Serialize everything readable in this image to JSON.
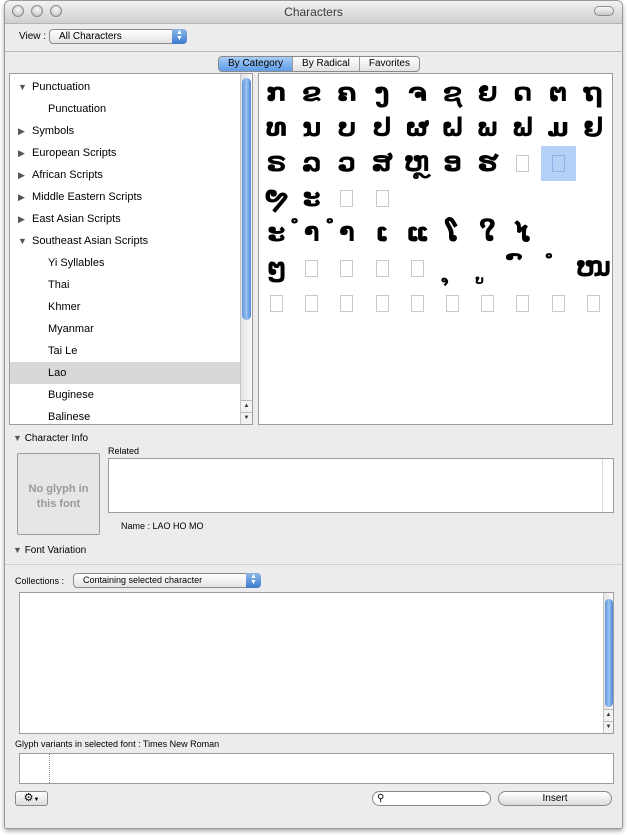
{
  "window": {
    "title": "Characters"
  },
  "view": {
    "label": "View :",
    "value": "All Characters"
  },
  "tabs": [
    "By Category",
    "By Radical",
    "Favorites"
  ],
  "categories": [
    {
      "label": "Punctuation",
      "expanded": true,
      "level": 0
    },
    {
      "label": "Punctuation",
      "level": 1
    },
    {
      "label": "Symbols",
      "expanded": false,
      "level": 0
    },
    {
      "label": "European Scripts",
      "expanded": false,
      "level": 0
    },
    {
      "label": "African Scripts",
      "expanded": false,
      "level": 0
    },
    {
      "label": "Middle Eastern Scripts",
      "expanded": false,
      "level": 0
    },
    {
      "label": "East Asian Scripts",
      "expanded": false,
      "level": 0
    },
    {
      "label": "Southeast Asian Scripts",
      "expanded": true,
      "level": 0
    },
    {
      "label": "Yi Syllables",
      "level": 1
    },
    {
      "label": "Thai",
      "level": 1
    },
    {
      "label": "Khmer",
      "level": 1
    },
    {
      "label": "Myanmar",
      "level": 1
    },
    {
      "label": "Tai Le",
      "level": 1
    },
    {
      "label": "Lao",
      "level": 1,
      "selected": true
    },
    {
      "label": "Buginese",
      "level": 1
    },
    {
      "label": "Balinese",
      "level": 1
    }
  ],
  "characters": [
    [
      "ກ",
      "ຂ",
      "ຄ",
      "ງ",
      "ຈ",
      "ຊ",
      "ຍ",
      "ດ",
      "ຕ",
      "ຖ"
    ],
    [
      "ທ",
      "ນ",
      "ບ",
      "ປ",
      "ຜ",
      "ຝ",
      "ພ",
      "ຟ",
      "ມ",
      "ຢ"
    ],
    [
      "ຣ",
      "ລ",
      "ວ",
      "ສ",
      "ຫ",
      "ອ",
      "ຮ",
      "",
      "",
      ""
    ],
    [
      "ຯ",
      "ະ",
      "",
      "",
      "ໂ",
      "ໃ",
      "ໄ",
      "ໆ",
      "",
      ""
    ],
    [
      "໋",
      "໌",
      "",
      "",
      "",
      "",
      "",
      "",
      "",
      ""
    ],
    [
      "",
      "",
      "",
      "",
      "",
      "",
      "",
      "",
      "",
      ""
    ]
  ],
  "character_grid_display": [
    [
      "ກ",
      "ຂ",
      "ຄ",
      "ງ",
      "ຈ",
      "ຊ",
      "ຍ",
      "ດ",
      "ຕ",
      "ຖ"
    ],
    [
      "ທ",
      "ນ",
      "ບ",
      "ປ",
      "ຜ",
      "ຝ",
      "ພ",
      "ຟ",
      "ມ",
      "ຢ"
    ],
    [
      "ຣ",
      "ລ",
      "ວ",
      "ສ",
      "ຫຼ",
      "ອ",
      "ຮ",
      "□",
      "□sel",
      ""
    ],
    [
      "ຯ",
      "ະ",
      "□",
      "□",
      "",
      "",
      "",
      "",
      "",
      ""
    ],
    [
      "ະ",
      "ຳ",
      "ໍາ",
      "ເ",
      "ແ",
      "ໂ",
      "ໃ",
      "ໄ",
      "",
      ""
    ],
    [
      "ໆ",
      "□",
      "□",
      "□",
      "□",
      "ຸ",
      "ູ",
      "ົ",
      "ໍ",
      "ໜ"
    ],
    [
      "□",
      "□",
      "□",
      "□",
      "□",
      "□",
      "□",
      "□",
      "□",
      "□"
    ]
  ],
  "info": {
    "section_label": "Character Info",
    "preview": "No glyph in this font",
    "related_label": "Related",
    "name_label": "Name :",
    "name_value": "LAO HO MO"
  },
  "font_variation": {
    "section_label": "Font Variation",
    "collections_label": "Collections :",
    "collections_value": "Containing selected character",
    "glyph_variants_label": "Glyph variants in selected font :",
    "glyph_variants_font": "Times New Roman"
  },
  "footer": {
    "insert_label": "Insert",
    "search_placeholder": ""
  }
}
